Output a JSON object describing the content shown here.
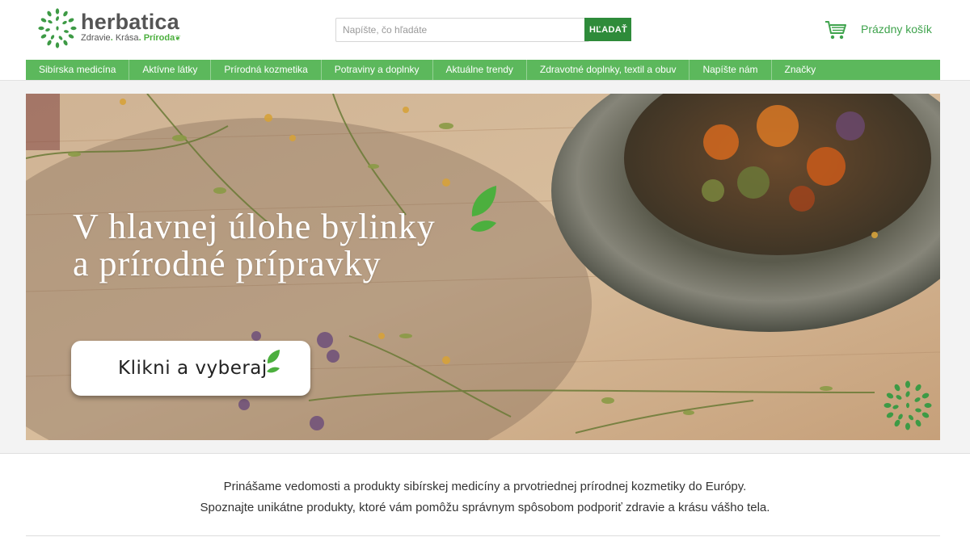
{
  "brand": {
    "name": "herbatica",
    "tagline_1": "Zdravie",
    "tagline_2": "Krása",
    "tagline_3": "Príroda"
  },
  "search": {
    "placeholder": "Napíšte, čo hľadáte",
    "value": "",
    "button_label": "HĽADAŤ"
  },
  "cart": {
    "label": "Prázdny košík",
    "icon": "cart-icon"
  },
  "nav": {
    "items": [
      {
        "label": "Sibírska medicína"
      },
      {
        "label": "Aktívne látky"
      },
      {
        "label": "Prírodná kozmetika"
      },
      {
        "label": "Potraviny a doplnky"
      },
      {
        "label": "Aktuálne trendy"
      },
      {
        "label": "Zdravotné doplnky, textil a obuv"
      },
      {
        "label": "Napíšte nám"
      },
      {
        "label": "Značky"
      }
    ]
  },
  "hero": {
    "title_line_1": "V hlavnej úlohe bylinky",
    "title_line_2": "a prírodné prípravky",
    "cta_label": "Klikni a vyberaj"
  },
  "intro": {
    "line_1": "Prinášame vedomosti a produkty sibírskej medicíny a prvotriednej prírodnej kozmetiky do Európy.",
    "line_2": "Spoznajte unikátne produkty, ktoré vám pomôžu správnym spôsobom podporiť zdravie a krásu vášho tela."
  },
  "colors": {
    "accent_green": "#5cb85c",
    "button_green": "#2e8b3a",
    "text_dark": "#333333"
  }
}
